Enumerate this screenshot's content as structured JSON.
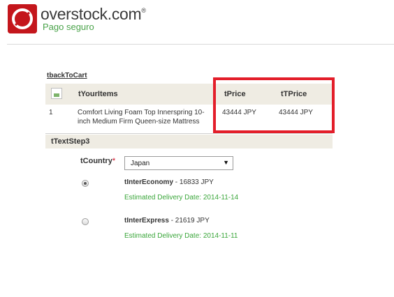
{
  "header": {
    "brand_name": "overstock.com",
    "brand_reg": "®",
    "subtitle": "Pago seguro"
  },
  "back_link": "tbackToCart",
  "items_table": {
    "headers": {
      "items": "tYourItems",
      "price": "tPrice",
      "total_price": "tTPrice"
    },
    "rows": [
      {
        "qty": "1",
        "name_line1": "Comfort Living Foam Top Innerspring 10-",
        "name_line2": "inch Medium Firm Queen-size Mattress",
        "price": "43444 JPY",
        "total": "43444 JPY"
      }
    ]
  },
  "step3": {
    "title": "tTextStep3",
    "country_label": "tCountry",
    "required_mark": "*",
    "country_value": "Japan",
    "dropdown_arrow": "▼",
    "shipping_options": [
      {
        "name": "tInterEconomy",
        "price": " - 16833 JPY",
        "eta": "Estimated Delivery Date: 2014-11-14",
        "selected": true
      },
      {
        "name": "tInterExpress",
        "price": " - 21619 JPY",
        "eta": "Estimated Delivery Date: 2014-11-11",
        "selected": false
      }
    ]
  },
  "colors": {
    "brand_red": "#c4161c",
    "subtitle_green": "#4aa34a",
    "eta_green": "#3aa63a",
    "highlight_red": "#e31e2a",
    "table_header_bg": "#efece3"
  },
  "icons": {
    "logo": "overstock-o-logo",
    "product_image": "broken-image-icon"
  }
}
